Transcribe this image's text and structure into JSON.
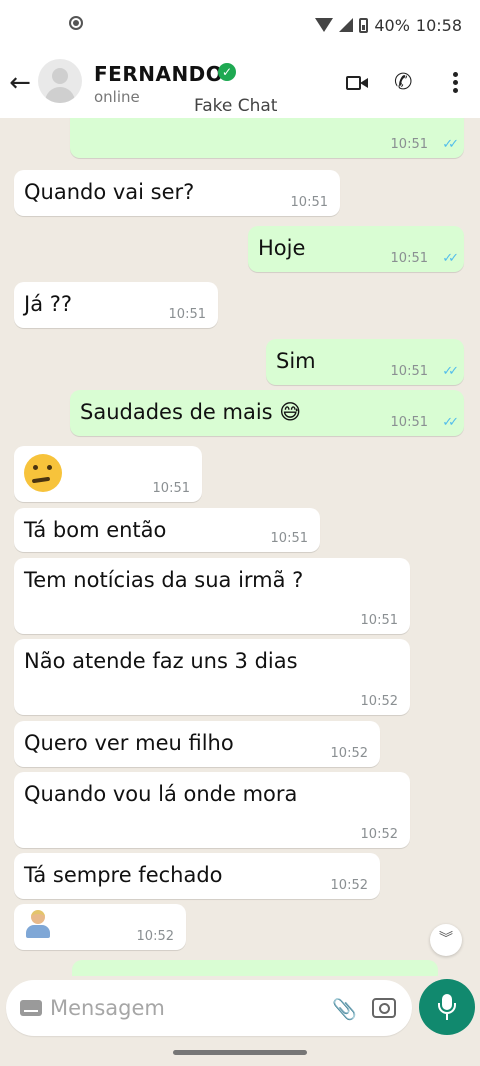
{
  "status_bar": {
    "battery": "40%",
    "time": "10:58",
    "icons": [
      "location-icon",
      "wifi-icon",
      "signal-icon",
      "battery-icon"
    ]
  },
  "header": {
    "contact_name": "FERNANDO",
    "contact_status": "online",
    "watermark": "Fake Chat",
    "back_icon": "←",
    "phone_icon": "✆",
    "icons": [
      "back-arrow-icon",
      "avatar",
      "verified-icon",
      "video-call-icon",
      "phone-call-icon",
      "more-options-icon"
    ]
  },
  "messages": [
    {
      "dir": "out",
      "text": "",
      "time": "10:51",
      "ticks": "✓✓"
    },
    {
      "dir": "in",
      "text": "Quando vai ser?",
      "time": "10:51"
    },
    {
      "dir": "out",
      "text": "Hoje",
      "time": "10:51",
      "ticks": "✓✓"
    },
    {
      "dir": "in",
      "text": "Já ??",
      "time": "10:51"
    },
    {
      "dir": "out",
      "text": "Sim",
      "time": "10:51",
      "ticks": "✓✓"
    },
    {
      "dir": "out",
      "text": "Saudades de mais 😅",
      "time": "10:51",
      "ticks": "✓✓"
    },
    {
      "dir": "in",
      "text": "",
      "emoji": "thinking-face",
      "time": "10:51"
    },
    {
      "dir": "in",
      "text": "Tá bom então",
      "time": "10:51"
    },
    {
      "dir": "in",
      "text": "Tem notícias da sua irmã ?",
      "time": "10:51"
    },
    {
      "dir": "in",
      "text": "Não atende faz uns 3 dias",
      "time": "10:52"
    },
    {
      "dir": "in",
      "text": "Quero ver meu filho",
      "time": "10:52"
    },
    {
      "dir": "in",
      "text": "Quando vou lá onde mora",
      "time": "10:52"
    },
    {
      "dir": "in",
      "text": "Tá sempre fechado",
      "time": "10:52"
    },
    {
      "dir": "in",
      "text": "",
      "emoji": "person-shrugging",
      "time": "10:52"
    }
  ],
  "scroll_down_icon": "︾",
  "composer": {
    "placeholder": "Mensagem",
    "clip_icon": "📎",
    "icons": [
      "keyboard-icon",
      "attach-icon",
      "camera-icon",
      "mic-icon"
    ]
  },
  "colors": {
    "chat_bg": "#efeae2",
    "incoming": "#ffffff",
    "outgoing": "#d9fdd3",
    "accent": "#11896e",
    "read_ticks": "#53bdeb",
    "verified": "#1ea952"
  }
}
